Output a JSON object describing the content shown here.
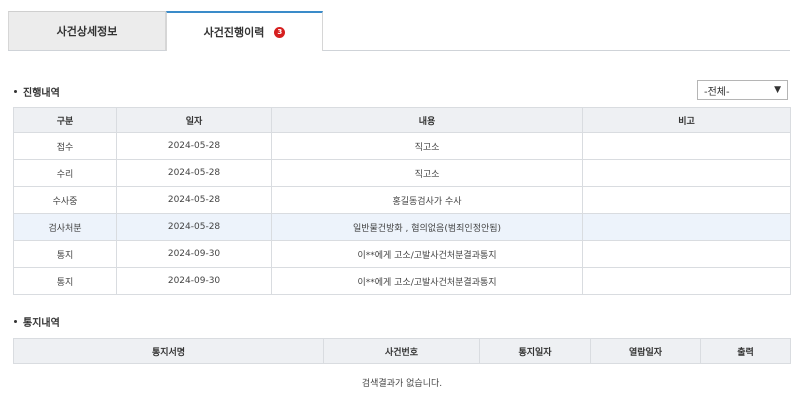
{
  "tabs": [
    {
      "label": "사건상세정보",
      "active": false
    },
    {
      "label": "사건진행이력",
      "active": true,
      "badge": "3"
    }
  ],
  "progress": {
    "title": "진행내역",
    "filter": {
      "selected": "-전체-",
      "icon": "chevron-down-icon"
    },
    "columns": [
      "구분",
      "일자",
      "내용",
      "비고"
    ],
    "rows": [
      {
        "type": "접수",
        "date": "2024-05-28",
        "content": "직고소",
        "note": ""
      },
      {
        "type": "수리",
        "date": "2024-05-28",
        "content": "직고소",
        "note": ""
      },
      {
        "type": "수사중",
        "date": "2024-05-28",
        "content": "홍길동검사가 수사",
        "note": ""
      },
      {
        "type": "검사처분",
        "date": "2024-05-28",
        "content": "일반물건방화 , 혐의없음(범죄인정안됨)",
        "note": ""
      },
      {
        "type": "통지",
        "date": "2024-09-30",
        "content": "이**에게 고소/고발사건처분결과통지",
        "note": ""
      },
      {
        "type": "통지",
        "date": "2024-09-30",
        "content": "이**에게 고소/고발사건처분결과통지",
        "note": ""
      }
    ]
  },
  "notice": {
    "title": "통지내역",
    "columns": [
      "통지서명",
      "사건번호",
      "통지일자",
      "열람일자",
      "출력"
    ],
    "empty_message": "검색결과가 없습니다."
  },
  "colors": {
    "accent": "#3a8bc9",
    "badge": "#d61f1f",
    "header_bg": "#eef0f3",
    "highlight_row": "#edf3fb"
  }
}
